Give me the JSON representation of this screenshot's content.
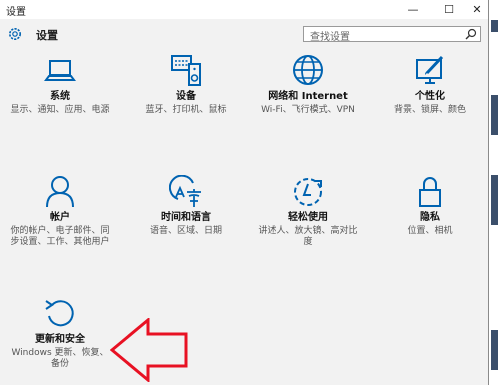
{
  "window": {
    "title": "设置",
    "minimize": "—",
    "maximize": "☐",
    "close": "✕"
  },
  "header": {
    "title": "设置"
  },
  "search": {
    "placeholder": "查找设置"
  },
  "tiles": [
    {
      "name": "系统",
      "desc": "显示、通知、应用、电源",
      "icon": "laptop-icon"
    },
    {
      "name": "设备",
      "desc": "蓝牙、打印机、鼠标",
      "icon": "keyboard-speaker-icon"
    },
    {
      "name": "网络和 Internet",
      "desc": "Wi-Fi、飞行模式、VPN",
      "icon": "globe-icon"
    },
    {
      "name": "个性化",
      "desc": "背景、锁屏、颜色",
      "icon": "paint-monitor-icon"
    },
    {
      "name": "帐户",
      "desc": "你的帐户、电子邮件、同步设置、工作、其他用户",
      "icon": "person-icon"
    },
    {
      "name": "时间和语言",
      "desc": "语音、区域、日期",
      "icon": "time-language-icon"
    },
    {
      "name": "轻松使用",
      "desc": "讲述人、放大镜、高对比度",
      "icon": "ease-of-access-icon"
    },
    {
      "name": "隐私",
      "desc": "位置、相机",
      "icon": "lock-icon"
    },
    {
      "name": "更新和安全",
      "desc": "Windows 更新、恢复、备份",
      "icon": "refresh-icon"
    }
  ],
  "colors": {
    "accent": "#0063b1",
    "arrow": "#e81123"
  }
}
